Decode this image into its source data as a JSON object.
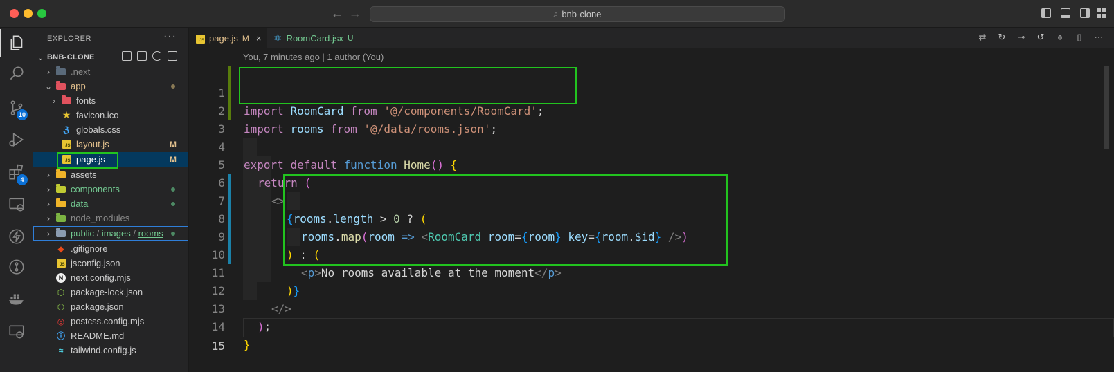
{
  "window": {
    "search_text": "bnb-clone"
  },
  "activity_bar": {
    "scm_badge": "10",
    "extensions_badge": "4"
  },
  "sidebar": {
    "title": "EXPLORER",
    "more": "···",
    "root": "BNB-CLONE",
    "items": [
      {
        "label": ".next"
      },
      {
        "label": "app"
      },
      {
        "label": "fonts"
      },
      {
        "label": "favicon.ico"
      },
      {
        "label": "globals.css"
      },
      {
        "label": "layout.js",
        "status": "M"
      },
      {
        "label": "page.js",
        "status": "M"
      },
      {
        "label": "assets"
      },
      {
        "label": "components"
      },
      {
        "label": "data"
      },
      {
        "label": "node_modules"
      },
      {
        "label_parts": [
          "public",
          "images",
          "rooms"
        ]
      },
      {
        "label": ".gitignore"
      },
      {
        "label": "jsconfig.json"
      },
      {
        "label": "next.config.mjs"
      },
      {
        "label": "package-lock.json"
      },
      {
        "label": "package.json"
      },
      {
        "label": "postcss.config.mjs"
      },
      {
        "label": "README.md"
      },
      {
        "label": "tailwind.config.js"
      }
    ],
    "colors": {
      "modified": "#e2c08d",
      "untracked": "#73c991",
      "selection": "#04395e"
    }
  },
  "tabs": [
    {
      "label": "page.js",
      "status": "M",
      "close": "×"
    },
    {
      "label": "RoomCard.jsx",
      "status": "U"
    }
  ],
  "editor": {
    "blame": "You, 7 minutes ago | 1 author (You)",
    "line_numbers": [
      "1",
      "2",
      "3",
      "4",
      "5",
      "6",
      "7",
      "8",
      "9",
      "10",
      "11",
      "12",
      "13",
      "14",
      "15"
    ],
    "lines": {
      "l1": {
        "kw_import": "import",
        "ident": "RoomCard",
        "kw_from": "from",
        "str": "'@/components/RoomCard'",
        "semi": ";"
      },
      "l2": {
        "kw_import": "import",
        "ident": "rooms",
        "kw_from": "from",
        "str": "'@/data/rooms.json'",
        "semi": ";"
      },
      "l4": {
        "kw_export": "export",
        "kw_default": "default",
        "kw_function": "function",
        "fn": "Home",
        "parens": "()",
        "brace": "{"
      },
      "l5": {
        "kw_return": "return",
        "paren": "("
      },
      "l6": {
        "frag": "<>"
      },
      "l7": {
        "brace": "{",
        "obj": "rooms",
        "dot": ".",
        "prop": "length",
        "op": " > ",
        "num": "0",
        "tern": " ? ",
        "paren": "("
      },
      "l8": {
        "obj": "rooms",
        "dot": ".",
        "fn": "map",
        "paren_open": "(",
        "param": "room",
        "arrow": " => ",
        "lt": "<",
        "comp": "RoomCard",
        "attr1": "room",
        "eq1": "=",
        "b1o": "{",
        "v1": "room",
        "b1c": "}",
        "attr2": "key",
        "eq2": "=",
        "b2o": "{",
        "v2": "room",
        "dot2": ".",
        "v2prop": "$id",
        "b2c": "}",
        "selfclose": " />",
        "paren_close": ")"
      },
      "l9": {
        "paren_close": ")",
        "colon": " : ",
        "paren_open": "("
      },
      "l10": {
        "lt": "<",
        "tag": "p",
        "gt": ">",
        "text": "No rooms available at the moment",
        "lt2": "</",
        "tag2": "p",
        "gt2": ">"
      },
      "l11": {
        "paren": ")",
        "brace": "}"
      },
      "l12": {
        "frag_close": "</>"
      },
      "l13": {
        "paren": ")",
        "semi": ";"
      },
      "l14": {
        "brace": "}"
      }
    }
  },
  "highlight_color": "#22c31f"
}
